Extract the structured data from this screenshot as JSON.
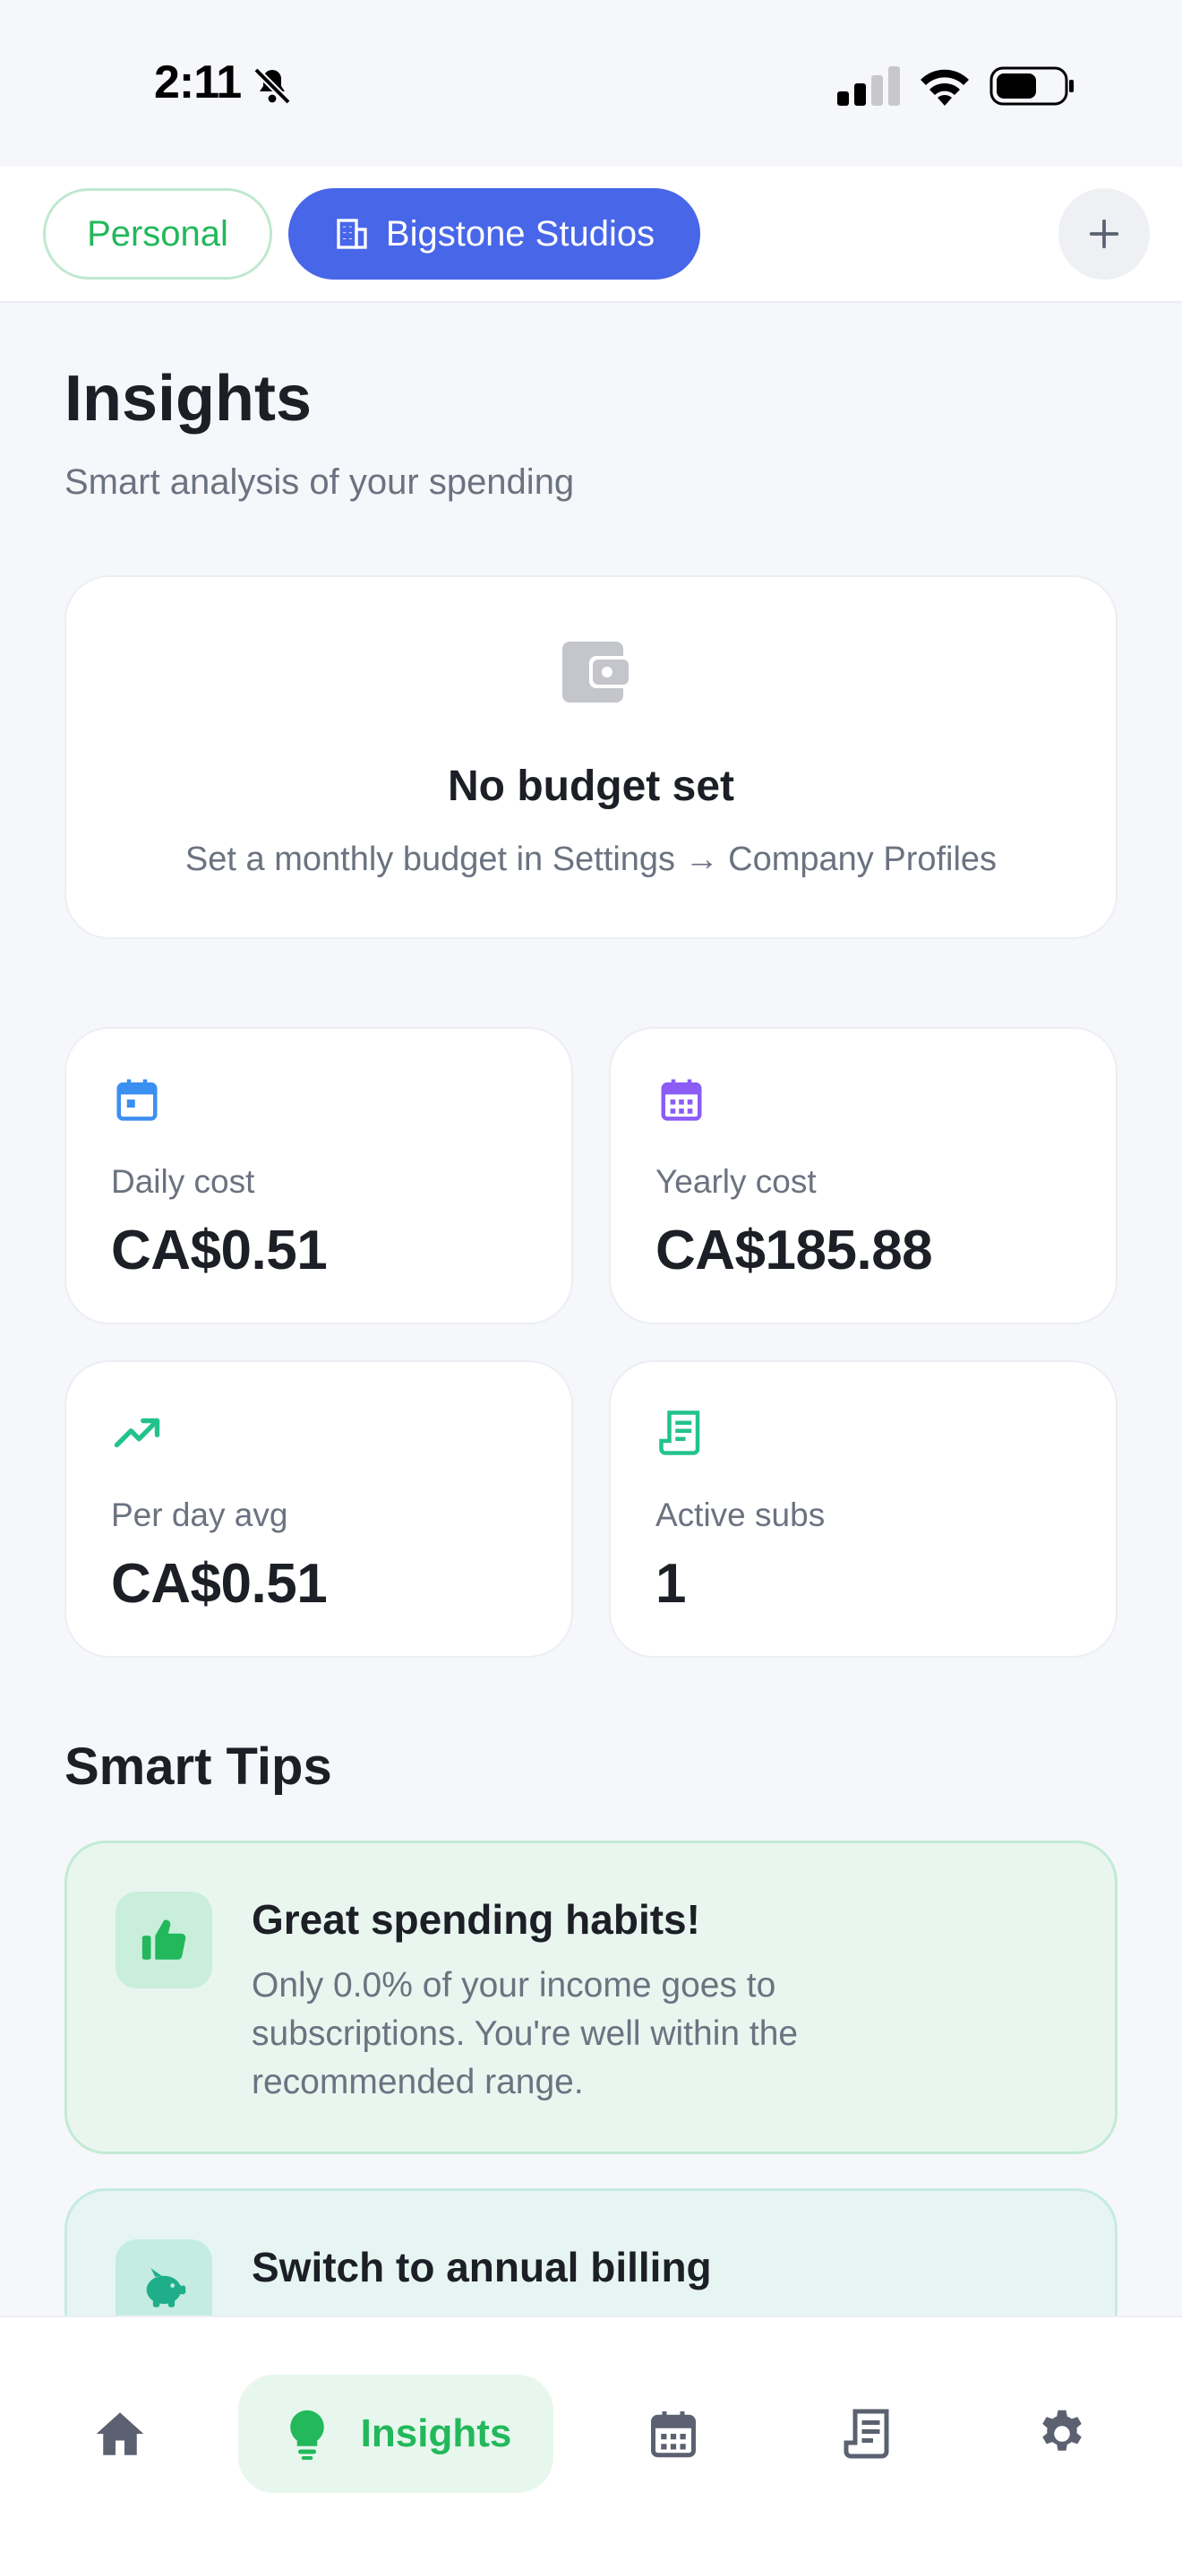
{
  "status_bar": {
    "time": "2:11"
  },
  "profiles": {
    "personal_label": "Personal",
    "company_label": "Bigstone Studios"
  },
  "header": {
    "title": "Insights",
    "subtitle": "Smart analysis of your spending"
  },
  "budget": {
    "title": "No budget set",
    "message": "Set a monthly budget in Settings → Company Profiles"
  },
  "stats": [
    {
      "label": "Daily cost",
      "value": "CA$0.51",
      "icon": "calendar-icon"
    },
    {
      "label": "Yearly cost",
      "value": "CA$185.88",
      "icon": "calendar-grid-icon"
    },
    {
      "label": "Per day avg",
      "value": "CA$0.51",
      "icon": "trending-up-icon"
    },
    {
      "label": "Active subs",
      "value": "1",
      "icon": "receipt-icon"
    }
  ],
  "tips_section": {
    "title": "Smart Tips",
    "tips": [
      {
        "title": "Great spending habits!",
        "body": "Only 0.0% of your income goes to subscriptions. You're well within the recommended range.",
        "icon": "thumbs-up-icon"
      },
      {
        "title": "Switch to annual billing",
        "body": "",
        "icon": "piggy-bank-icon"
      }
    ]
  },
  "tab_bar": {
    "active_label": "Insights",
    "items": [
      "home-icon",
      "lightbulb-icon",
      "calendar-icon",
      "receipt-icon",
      "gear-icon"
    ]
  },
  "colors": {
    "accent_green": "#22b85b",
    "accent_blue": "#4866e8",
    "background": "#f6f7fb",
    "text_secondary": "#6b7280",
    "icon_blue": "#3b8ff0",
    "icon_purple": "#8b5cf6",
    "icon_green": "#22c38a"
  }
}
